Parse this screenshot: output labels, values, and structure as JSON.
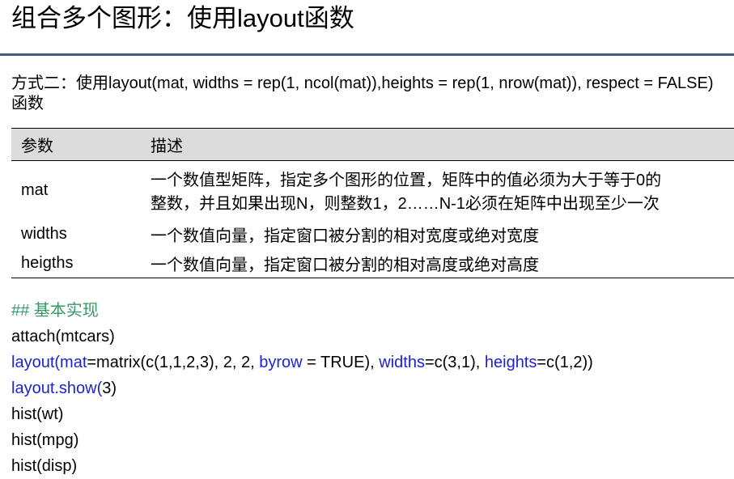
{
  "title": "组合多个图形：使用layout函数",
  "subtitle": "方式二：使用layout(mat, widths = rep(1, ncol(mat)),heights = rep(1, nrow(mat)), respect = FALSE)函数",
  "table": {
    "headers": [
      "参数",
      "描述"
    ],
    "rows": [
      {
        "name": "mat",
        "desc_lines": [
          "一个数值型矩阵，指定多个图形的位置，矩阵中的值必须为大于等于0的",
          "整数，并且如果出现N，则整数1，2……N-1必须在矩阵中出现至少一次"
        ]
      },
      {
        "name": "widths",
        "desc": "一个数值向量，指定窗口被分割的相对宽度或绝对宽度"
      },
      {
        "name": "heigths",
        "desc": "一个数值向量，指定窗口被分割的相对高度或绝对高度"
      }
    ]
  },
  "code": {
    "comment": "## 基本实现",
    "line1": "attach(mtcars)",
    "line2": {
      "fn": "layout(",
      "arg1": "mat",
      "seg1": "=matrix(c(1,1,2,3), 2, 2, ",
      "arg2": "byrow",
      "seg2": " = TRUE), ",
      "arg3": "widths",
      "seg3": "=c(3,1), ",
      "arg4": "heights",
      "seg4": "=c(1,2))"
    },
    "line3": {
      "fn": "layout.show(",
      "seg": "3)"
    },
    "line4": "hist(wt)",
    "line5": "hist(mpg)",
    "line6": "hist(disp)"
  },
  "colors": {
    "title_rule": "#3e5e86",
    "header_bg": "#dcdcdc",
    "comment": "#339966",
    "keyword": "#1f1fd4"
  }
}
